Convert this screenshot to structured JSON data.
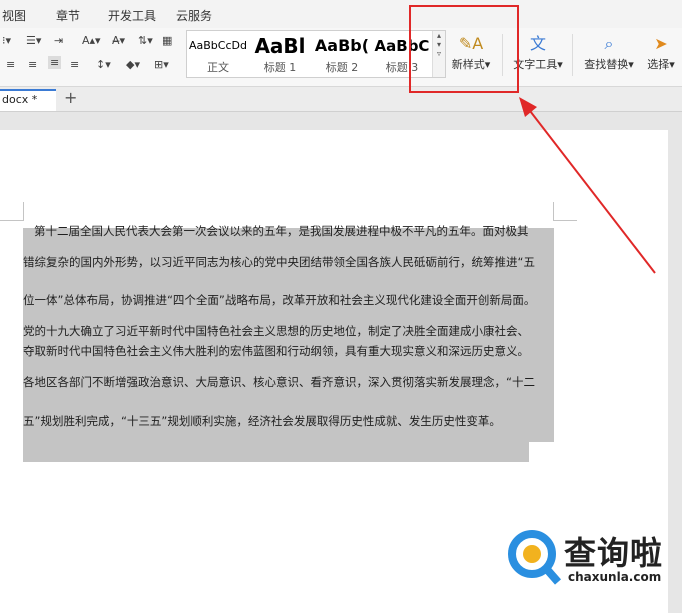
{
  "menu": {
    "view": "视图",
    "chapter": "章节",
    "dev_tools": "开发工具",
    "cloud": "云服务"
  },
  "ribbon": {
    "styles": [
      {
        "preview": "AaBbCcDd",
        "label": "正文"
      },
      {
        "preview": "AaBl",
        "label": "标题 1"
      },
      {
        "preview": "AaBb(",
        "label": "标题 2"
      },
      {
        "preview": "AaBbC",
        "label": "标题 3"
      }
    ],
    "new_style": "新样式",
    "text_tools": "文字工具",
    "find_replace": "查找替换",
    "select": "选择"
  },
  "tabs": {
    "doc_name": "docx *",
    "add": "+"
  },
  "document": {
    "lines": [
      "第十二届全国人民代表大会第一次会议以来的五年，是我国发展进程中极不平凡的五年。面对极其",
      "错综复杂的国内外形势，以习近平同志为核心的党中央团结带领全国各族人民砥砺前行，统筹推进“五",
      "位一体”总体布局，协调推进“四个全面”战略布局，改革开放和社会主义现代化建设全面开创新局面。",
      "党的十九大确立了习近平新时代中国特色社会主义思想的历史地位，制定了决胜全面建成小康社会、",
      "夺取新时代中国特色社会主义伟大胜利的宏伟蓝图和行动纲领，具有重大现实意义和深远历史意义。",
      "各地区各部门不断增强政治意识、大局意识、核心意识、看齐意识，深入贯彻落实新发展理念，“十二",
      "五”规划胜利完成，“十三五”规划顺利实施，经济社会发展取得历史性成就、发生历史性变革。"
    ]
  },
  "watermark": {
    "brand": "查询啦",
    "url": "chaxunla.com"
  },
  "colors": {
    "annotation": "#e02828",
    "selection": "#c4c4c4",
    "accent": "#3b7bd4"
  }
}
